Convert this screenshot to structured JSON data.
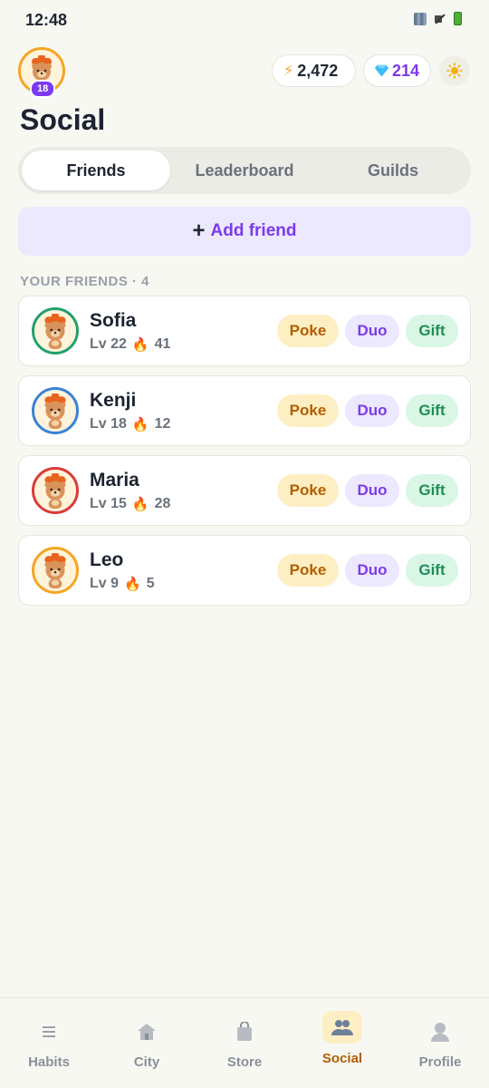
{
  "status": {
    "time": "12:48"
  },
  "header": {
    "level": "18",
    "coins": "2,472",
    "gems": "214",
    "title": "Social"
  },
  "tabs": [
    {
      "label": "Friends",
      "active": true
    },
    {
      "label": "Leaderboard",
      "active": false
    },
    {
      "label": "Guilds",
      "active": false
    }
  ],
  "add_friend": {
    "plus": "+",
    "label": "Add friend"
  },
  "section": {
    "label": "YOUR FRIENDS · 4"
  },
  "friends": [
    {
      "name": "Sofia",
      "level": "Lv 22",
      "streak": "41",
      "ring": "#22a06b"
    },
    {
      "name": "Kenji",
      "level": "Lv 18",
      "streak": "12",
      "ring": "#3b82d6"
    },
    {
      "name": "Maria",
      "level": "Lv 15",
      "streak": "28",
      "ring": "#dc3b3b"
    },
    {
      "name": "Leo",
      "level": "Lv 9",
      "streak": "5",
      "ring": "#f5a623"
    }
  ],
  "actions": {
    "poke": "Poke",
    "duo": "Duo",
    "gift": "Gift"
  },
  "nav": [
    {
      "label": "Habits",
      "icon": "list-icon",
      "active": false
    },
    {
      "label": "City",
      "icon": "house-icon",
      "active": false
    },
    {
      "label": "Store",
      "icon": "shopping-bag-icon",
      "active": false
    },
    {
      "label": "Social",
      "icon": "people-icon",
      "active": true
    },
    {
      "label": "Profile",
      "icon": "person-icon",
      "active": false
    }
  ],
  "colors": {
    "accent": "#7c3aed",
    "poke": "#b45c00",
    "gift": "#1f8f55",
    "background": "#f8f8f3"
  }
}
